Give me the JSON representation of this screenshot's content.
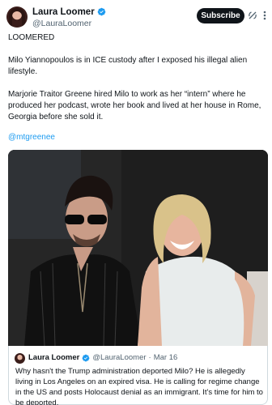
{
  "post": {
    "author_name": "Laura Loomer",
    "author_handle": "@LauraLoomer",
    "subscribe_label": "Subscribe",
    "paragraphs": [
      "LOOMERED",
      "Milo Yiannopoulos is in ICE custody after I exposed his illegal alien lifestyle.",
      "Marjorie Traitor Greene hired Milo to work as her “intern” where he produced her podcast, wrote her book and lived at her house in Rome, Georgia before she sold it."
    ],
    "mention": "@mtgreenee"
  },
  "quote": {
    "author_name": "Laura Loomer",
    "author_handle": "@LauraLoomer",
    "separator": "·",
    "date": "Mar 16",
    "text": "Why hasn't the Trump administration deported Milo? He is allegedly living in Los Angeles on an expired visa. He is calling for regime change in the US and posts Holocaust denial as an immigrant. It's time for him to be deported."
  },
  "colors": {
    "link": "#1d9bf0",
    "verified": "#1d9bf0",
    "secondary_text": "#536471",
    "subscribe_bg": "#0f1419"
  },
  "icons": [
    "verified-badge-icon",
    "grok-icon",
    "more-icon"
  ]
}
